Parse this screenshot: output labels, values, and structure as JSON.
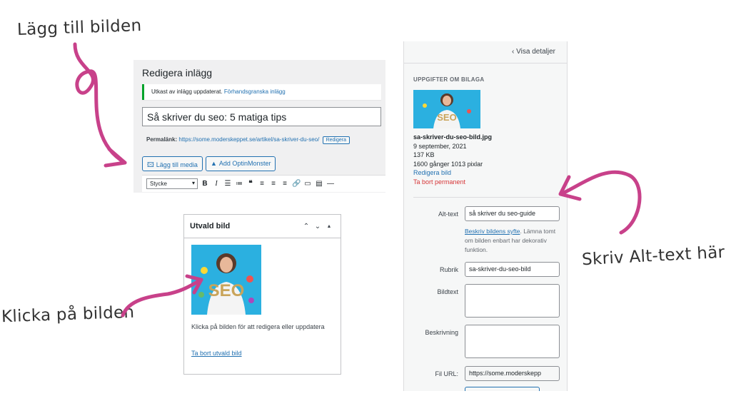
{
  "annotations": {
    "add_image": "Lägg till bilden",
    "click_image": "Klicka på bilden",
    "write_alt": "Skriv Alt-text här"
  },
  "colors": {
    "arrow": "#c8418a",
    "accent": "#2271b1",
    "notice_border": "#00a32a",
    "danger": "#d63638"
  },
  "editor": {
    "title": "Redigera inlägg",
    "notice_text": "Utkast av inlägg uppdaterat.",
    "notice_link": "Förhandsgranska inlägg",
    "post_title": "Så skriver du seo: 5 matiga tips",
    "permalink_label": "Permalänk:",
    "permalink_url": "https://some.moderskeppet.se/artikel/sa-skriver-du-seo/",
    "permalink_edit": "Redigera",
    "add_media": "Lägg till media",
    "add_optin": "Add OptinMonster",
    "format_select": "Stycke",
    "toolbar_icons": [
      "bold-icon",
      "italic-icon",
      "bullet-list-icon",
      "numbered-list-icon",
      "blockquote-icon",
      "align-left-icon",
      "align-center-icon",
      "align-right-icon",
      "link-icon",
      "read-more-icon",
      "toolbar-toggle-icon",
      "horizontal-line-icon"
    ]
  },
  "featured": {
    "title": "Utvald bild",
    "description": "Klicka på bilden för att redigera eller uppdatera",
    "remove_link": "Ta bort utvald bild",
    "image_text": "SEO"
  },
  "attachment": {
    "back_link": "Visa detaljer",
    "section_title": "UPPGIFTER OM BILAGA",
    "filename": "sa-skriver-du-seo-bild.jpg",
    "date": "9 september, 2021",
    "size": "137 KB",
    "dimensions": "1600 gånger 1013 pixlar",
    "edit_image": "Redigera bild",
    "delete_permanent": "Ta bort permanent",
    "alt_label": "Alt-text",
    "alt_value": "så skriver du seo-guide",
    "help_link": "Beskriv bildens syfte",
    "help_text": ". Lämna tomt om bilden enbart har dekorativ funktion.",
    "caption_title_label": "Rubrik",
    "caption_title_value": "sa-skriver-du-seo-bild",
    "image_caption_label": "Bildtext",
    "image_caption_value": "",
    "description_label": "Beskrivning",
    "description_value": "",
    "file_url_label": "Fil URL:",
    "file_url_value": "https://some.moderskepp"
  }
}
